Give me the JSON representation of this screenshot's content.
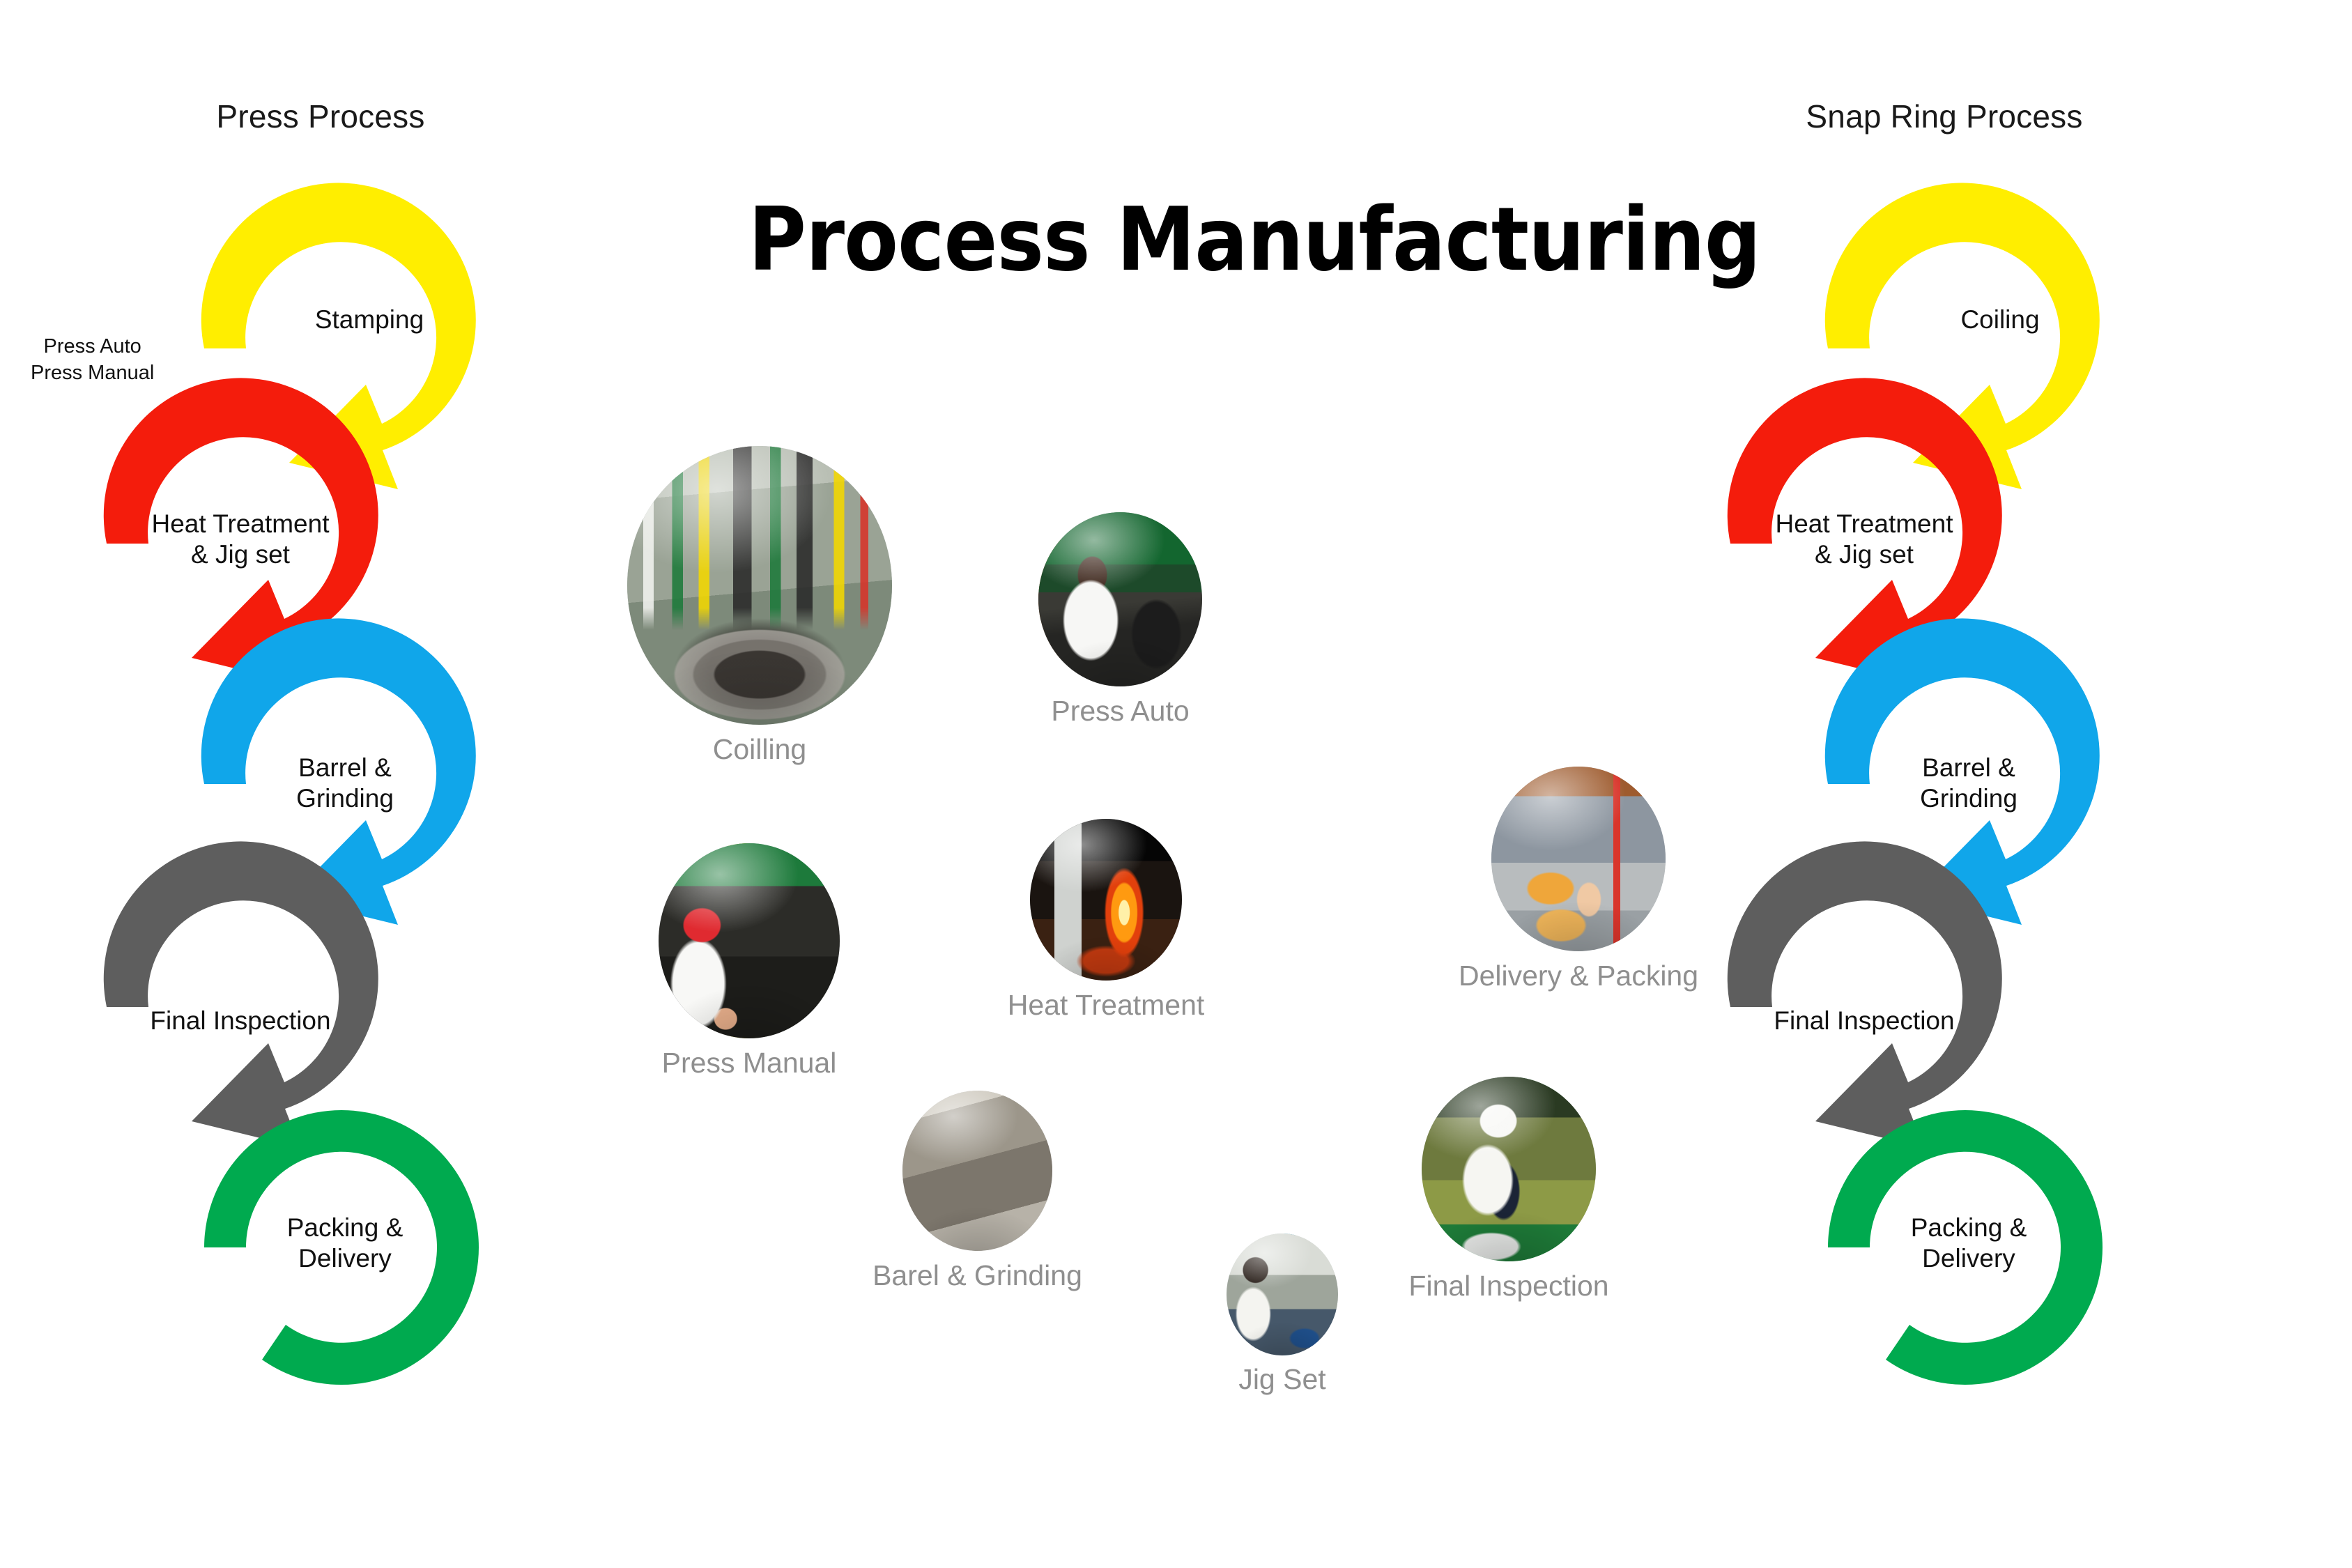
{
  "title": "Process Manufacturing",
  "columns": {
    "left": {
      "heading": "Press Process",
      "note": "Press Auto\nPress Manual",
      "note_line1": "Press Auto",
      "note_line2": "Press Manual",
      "steps": [
        {
          "label": "Stamping",
          "color": "#ffee00"
        },
        {
          "label": "Heat Treatment\n& Jig set",
          "color": "#f41c0c"
        },
        {
          "label": "Barrel &\nGrinding",
          "color": "#10a6ea"
        },
        {
          "label": "Final Inspection",
          "color": "#5e5e5e"
        },
        {
          "label": "Packing &\nDelivery",
          "color": "#00aa4f"
        }
      ]
    },
    "right": {
      "heading": "Snap Ring Process",
      "steps": [
        {
          "label": "Coiling",
          "color": "#ffee00"
        },
        {
          "label": "Heat Treatment\n& Jig set",
          "color": "#f41c0c"
        },
        {
          "label": "Barrel &\nGrinding",
          "color": "#10a6ea"
        },
        {
          "label": "Final Inspection",
          "color": "#5e5e5e"
        },
        {
          "label": "Packing &\nDelivery",
          "color": "#00aa4f"
        }
      ]
    }
  },
  "left_labels": {
    "s0a": "Stamping",
    "s1a": "Heat Treatment",
    "s1b": "& Jig set",
    "s2a": "Barrel &",
    "s2b": "Grinding",
    "s3a": "Final Inspection",
    "s4a": "Packing &",
    "s4b": "Delivery"
  },
  "right_labels": {
    "s0a": "Coiling",
    "s1a": "Heat Treatment",
    "s1b": "& Jig set",
    "s2a": "Barrel &",
    "s2b": "Grinding",
    "s3a": "Final Inspection",
    "s4a": "Packing &",
    "s4b": "Delivery"
  },
  "gallery": [
    {
      "caption": "Coilling",
      "name": "coilling"
    },
    {
      "caption": "Press Auto",
      "name": "press-auto"
    },
    {
      "caption": "Press Manual",
      "name": "press-manual"
    },
    {
      "caption": "Heat Treatment",
      "name": "heat-treatment"
    },
    {
      "caption": "Barel & Grinding",
      "name": "barel-grinding"
    },
    {
      "caption": "Jig Set",
      "name": "jig-set"
    },
    {
      "caption": "Delivery & Packing",
      "name": "delivery-packing"
    },
    {
      "caption": "Final Inspection",
      "name": "final-inspection"
    }
  ],
  "palette": {
    "yellow": "#ffee00",
    "red": "#f41c0c",
    "blue": "#10a6ea",
    "gray": "#5e5e5e",
    "green": "#00aa4f",
    "caption_gray": "#8f8f8f",
    "background": "#ffffff",
    "text": "#111111"
  }
}
